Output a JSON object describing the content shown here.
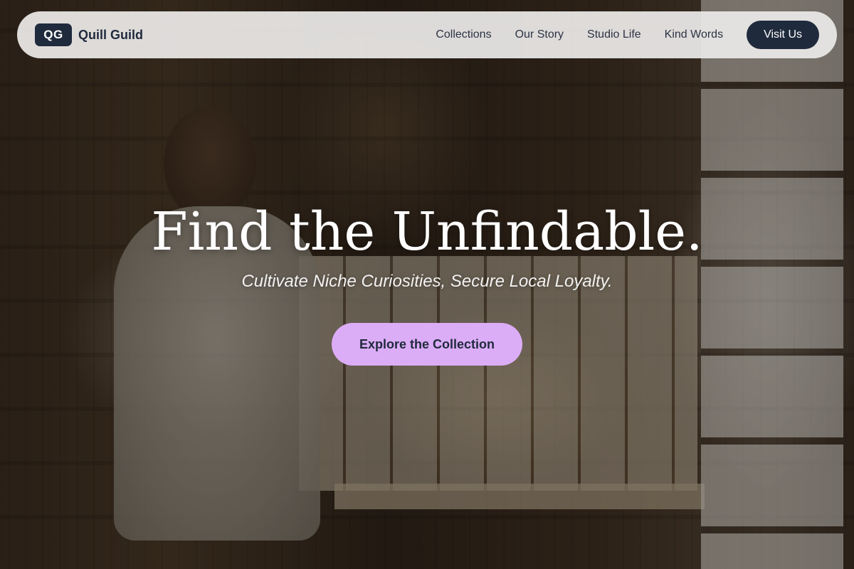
{
  "brand": {
    "badge": "QG",
    "name": "Quill Guild"
  },
  "nav": {
    "links": [
      "Collections",
      "Our Story",
      "Studio Life",
      "Kind Words"
    ],
    "cta_label": "Visit Us"
  },
  "hero": {
    "title": "Find the Unfindable.",
    "subtitle": "Cultivate Niche Curiosities, Secure Local Loyalty.",
    "cta_label": "Explore the Collection"
  },
  "colors": {
    "navy": "#1f2a3c",
    "accent_lilac": "#dcadf7",
    "nav_background": "#eceae8"
  }
}
